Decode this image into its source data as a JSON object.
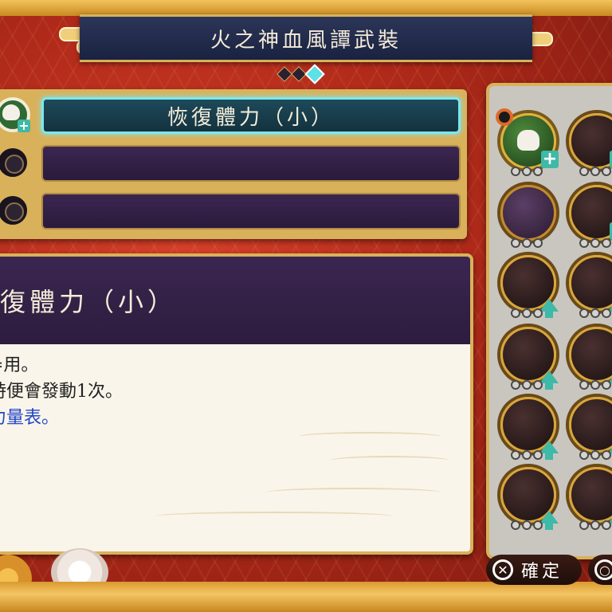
{
  "title": "火之神血風譚武裝",
  "page_indicator": {
    "total": 3,
    "active": 3
  },
  "slots": [
    {
      "label": "恢復體力（小）",
      "selected": true,
      "icon": "onigiri-heal-icon"
    },
    {
      "label": "",
      "selected": false,
      "icon": "empty-slot-icon"
    },
    {
      "label": "",
      "selected": false,
      "icon": "empty-slot-icon"
    }
  ],
  "detail": {
    "title": "復體力（小）",
    "lines": [
      {
        "text": "=用。",
        "color": "default"
      },
      {
        "text": "時便會發動1次。",
        "color": "default"
      },
      {
        "text": "力量表。",
        "color": "blue",
        "highlight": "力量表"
      }
    ]
  },
  "grid_items": [
    {
      "icon": "onigiri-heal-icon",
      "style": "green",
      "badge": "plus"
    },
    {
      "icon": "food-item-icon",
      "style": "brown",
      "badge": "plus"
    },
    {
      "icon": "sealed-scroll-icon",
      "style": "purple",
      "badge": "none"
    },
    {
      "icon": "gauge-item-icon",
      "style": "brown",
      "badge": "plus"
    },
    {
      "icon": "gauge-arrow-icon",
      "style": "brown",
      "badge": "up"
    },
    {
      "icon": "speed-meter-icon",
      "style": "brown",
      "badge": "up"
    },
    {
      "icon": "bomb-icon",
      "style": "brown",
      "badge": "up"
    },
    {
      "icon": "fire-palm-icon",
      "style": "brown",
      "badge": "up"
    },
    {
      "icon": "strike-icon",
      "style": "brown",
      "badge": "up"
    },
    {
      "icon": "running-icon",
      "style": "brown",
      "badge": "up"
    },
    {
      "icon": "fist-icon",
      "style": "brown",
      "badge": "up"
    },
    {
      "icon": "arm-icon",
      "style": "brown",
      "badge": "up"
    }
  ],
  "buttons": {
    "confirm_label": "確定",
    "confirm_glyph": "✕",
    "back_glyph": "○"
  },
  "colors": {
    "accent_teal": "#7ee6ee",
    "gold": "#d9b15a",
    "panel_purple": "#3b2650",
    "upgrade_arrow": "#3fb9a8"
  }
}
